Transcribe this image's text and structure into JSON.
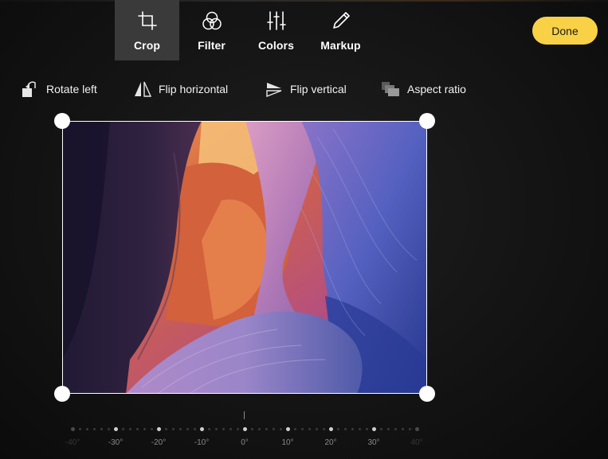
{
  "tabs": [
    {
      "label": "Crop",
      "icon": "crop-icon",
      "active": true
    },
    {
      "label": "Filter",
      "icon": "filter-icon",
      "active": false
    },
    {
      "label": "Colors",
      "icon": "sliders-icon",
      "active": false
    },
    {
      "label": "Markup",
      "icon": "pen-icon",
      "active": false
    }
  ],
  "done_label": "Done",
  "tools": [
    {
      "label": "Rotate left",
      "icon": "rotate-left-icon"
    },
    {
      "label": "Flip horizontal",
      "icon": "flip-horizontal-icon"
    },
    {
      "label": "Flip vertical",
      "icon": "flip-vertical-icon"
    },
    {
      "label": "Aspect ratio",
      "icon": "aspect-ratio-icon"
    }
  ],
  "straighten": {
    "value": 0,
    "labels": [
      "-40°",
      "-30°",
      "-20°",
      "-10°",
      "0°",
      "10°",
      "20°",
      "30°",
      "40°"
    ]
  },
  "colors": {
    "accent": "#f8d147",
    "active_tab": "#3a3a3a"
  }
}
